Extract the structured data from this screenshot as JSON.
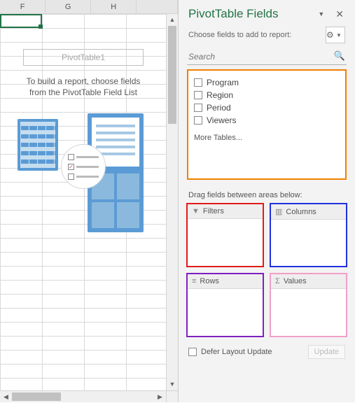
{
  "columns": [
    "F",
    "G",
    "H"
  ],
  "pivot": {
    "title": "PivotTable1",
    "hint1": "To build a report, choose fields",
    "hint2": "from the PivotTable Field List"
  },
  "pane": {
    "title": "PivotTable Fields",
    "subtitle": "Choose fields to add to report:",
    "search_placeholder": "Search",
    "fields": [
      "Program",
      "Region",
      "Period",
      "Viewers"
    ],
    "more": "More Tables...",
    "drag_label": "Drag fields between areas below:",
    "zones": {
      "filters": "Filters",
      "columns": "Columns",
      "rows": "Rows",
      "values": "Values"
    },
    "defer": "Defer Layout Update",
    "update": "Update"
  }
}
